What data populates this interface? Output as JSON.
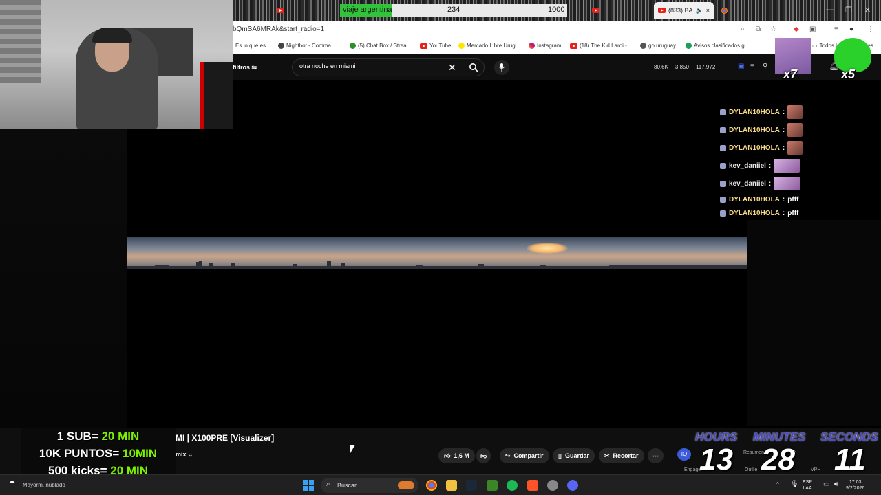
{
  "browser": {
    "poll": {
      "option_label": "viaje argentina",
      "value_a": "234",
      "value_b": "1000",
      "fill_fraction": 0.23
    },
    "active_tab": {
      "title": "(833) BA",
      "close": "×"
    },
    "url": "bQmSA6MRAk&start_radio=1",
    "bookmarks": [
      "Es lo que es...",
      "Nightbot - Comma...",
      "(5) Chat Box / Strea...",
      "YouTube",
      "Mercado Libre Urug...",
      "Instagram",
      "(18) The Kid Laroi -...",
      "go uruguay",
      "Avisos clasificados g...",
      "Todos los marcadores"
    ]
  },
  "youtube": {
    "filters_label": "filtros",
    "search_value": "otra noche en miami",
    "stats": [
      "80.6K",
      "3,850",
      "117,972"
    ],
    "video_title": "MI | X100PRE [Visualizer]",
    "mix_label": "mix",
    "like_count": "1,6 M",
    "share_label": "Compartir",
    "save_label": "Guardar",
    "clip_label": "Recortar",
    "more_label": "⋯",
    "side_labels": {
      "engage": "Engage",
      "outlier": "Outlie",
      "resume": "Resumen",
      "vph": "VPH",
      "ch": "ch"
    }
  },
  "chat": [
    {
      "user": "DYLAN10HOLA",
      "text": "",
      "color": "#f7d987",
      "emote": true,
      "wide": false
    },
    {
      "user": "DYLAN10HOLA",
      "text": "",
      "color": "#f7d987",
      "emote": true,
      "wide": false
    },
    {
      "user": "DYLAN10HOLA",
      "text": "",
      "color": "#f7d987",
      "emote": true,
      "wide": false
    },
    {
      "user": "kev_daniiel",
      "text": "",
      "color": "#e8e8e8",
      "emote": true,
      "wide": true
    },
    {
      "user": "kev_daniiel",
      "text": "",
      "color": "#e8e8e8",
      "emote": true,
      "wide": true
    },
    {
      "user": "DYLAN10HOLA",
      "text": "pfff",
      "color": "#f7d987",
      "emote": false,
      "wide": false
    },
    {
      "user": "DYLAN10HOLA",
      "text": "pfff",
      "color": "#f7d987",
      "emote": false,
      "wide": false
    }
  ],
  "emotes": {
    "multiplier_1": "x7",
    "multiplier_2": "x5"
  },
  "subathon": [
    {
      "left": "1 SUB= ",
      "right": "20 MIN"
    },
    {
      "left": "10K PUNTOS= ",
      "right": "10MIN"
    },
    {
      "left": "500 kicks= ",
      "right": "20 MIN"
    }
  ],
  "timer": {
    "hours_label": "HOURS",
    "minutes_label": "MINUTES",
    "seconds_label": "SECONDS",
    "hours": "13",
    "minutes": "28",
    "seconds": "11"
  },
  "taskbar": {
    "weather": "Mayorm. nublado",
    "search_label": "Buscar",
    "lang": "ESP",
    "region": "LAA",
    "time": "17:03",
    "date": "9/2/2026"
  },
  "colors": {
    "youtube_red": "#e62117",
    "poll_green": "#31c33a",
    "subathon_green": "#7cf000",
    "timer_label": "#4a4ac8"
  }
}
